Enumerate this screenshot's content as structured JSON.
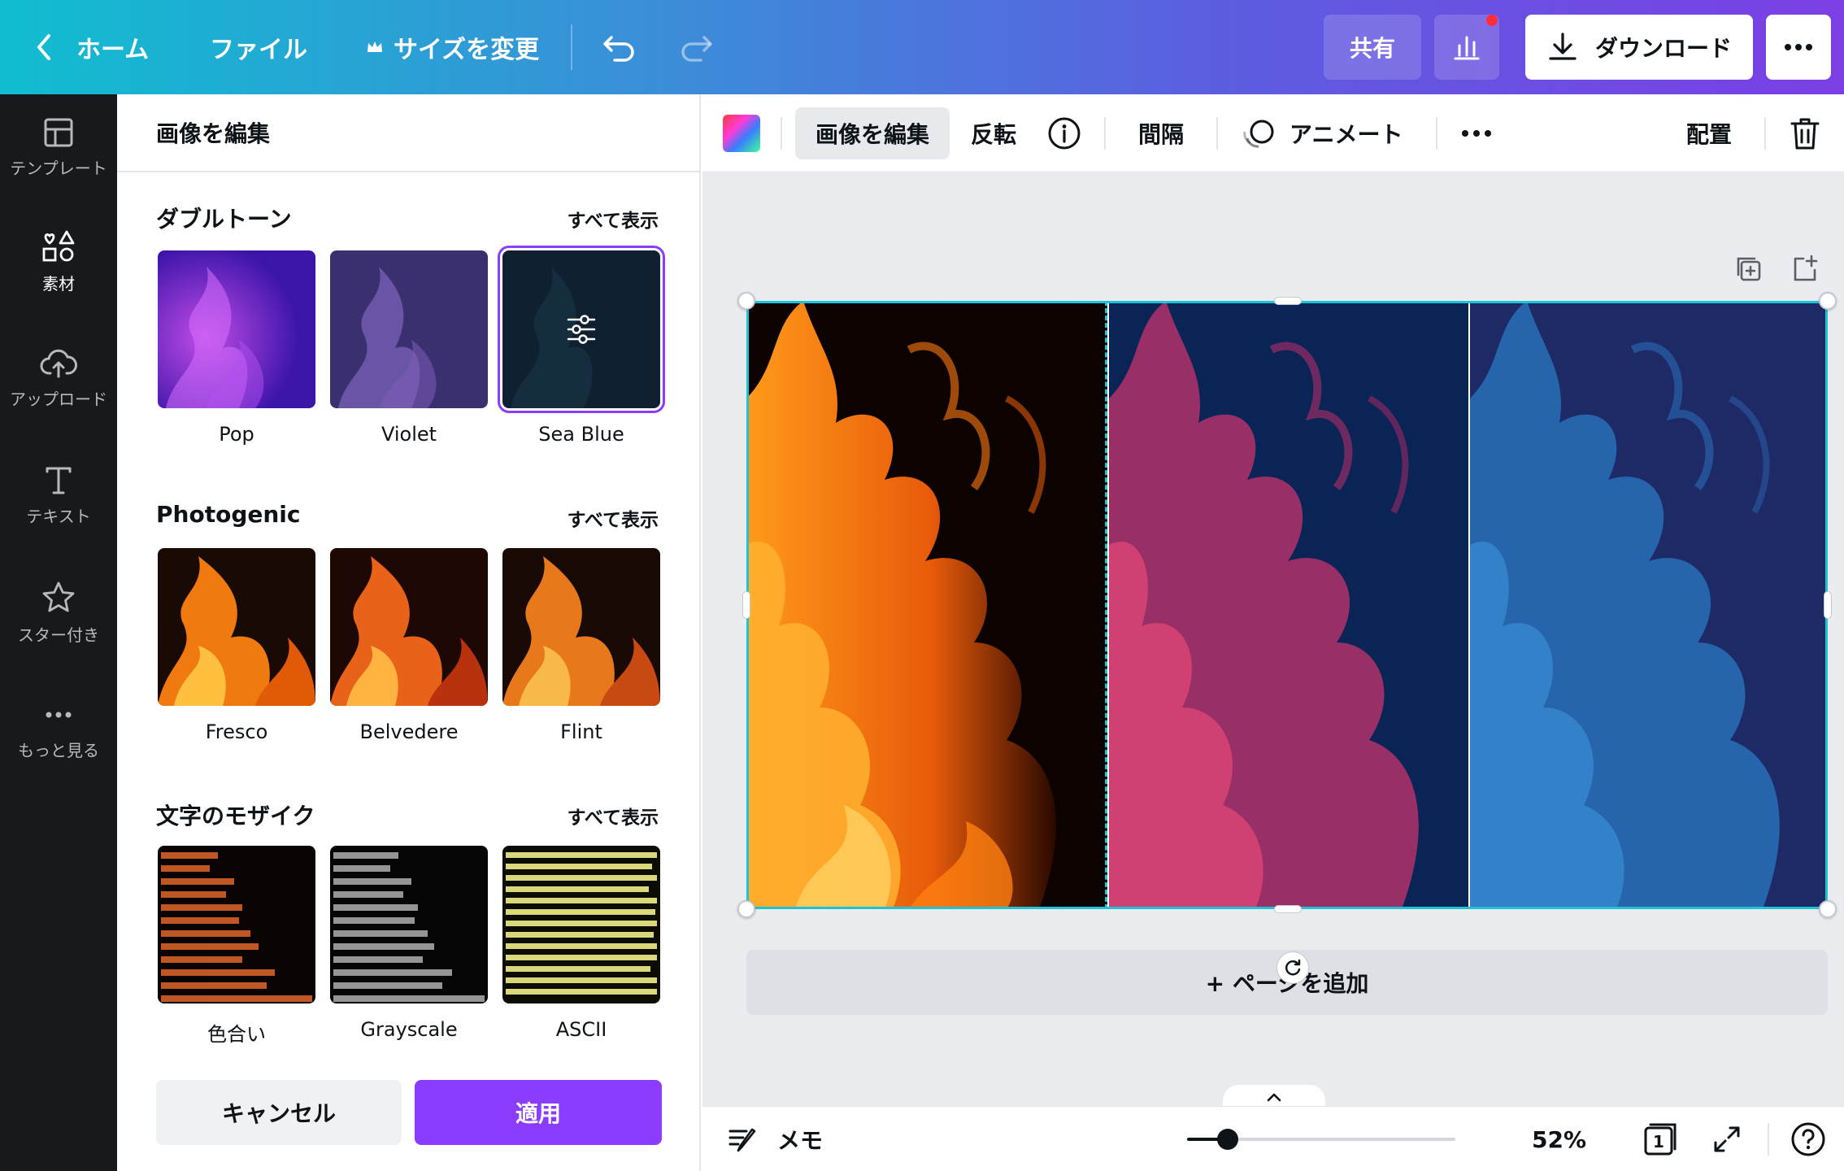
{
  "topbar": {
    "home_label": "ホーム",
    "file_label": "ファイル",
    "resize_label": "サイズを変更",
    "share_label": "共有",
    "download_label": "ダウンロード"
  },
  "rail": {
    "items": [
      {
        "label": "テンプレート",
        "icon": "template-icon"
      },
      {
        "label": "素材",
        "icon": "elements-icon"
      },
      {
        "label": "アップロード",
        "icon": "upload-cloud-icon"
      },
      {
        "label": "テキスト",
        "icon": "text-icon"
      },
      {
        "label": "スター付き",
        "icon": "star-icon"
      },
      {
        "label": "もっと見る",
        "icon": "more-dots-icon"
      }
    ]
  },
  "panel": {
    "title": "画像を編集",
    "sections": [
      {
        "title": "ダブルトーン",
        "show_all": "すべて表示",
        "items": [
          "Pop",
          "Violet",
          "Sea Blue"
        ]
      },
      {
        "title": "Photogenic",
        "show_all": "すべて表示",
        "items": [
          "Fresco",
          "Belvedere",
          "Flint"
        ]
      },
      {
        "title": "文字のモザイク",
        "show_all": "すべて表示",
        "items": [
          "色合い",
          "Grayscale",
          "ASCII"
        ]
      }
    ],
    "cancel_label": "キャンセル",
    "apply_label": "適用"
  },
  "context_bar": {
    "edit_image_label": "画像を編集",
    "flip_label": "反転",
    "spacing_label": "間隔",
    "animate_label": "アニメート",
    "position_label": "配置"
  },
  "canvas": {
    "add_page_label": "+ ページを追加"
  },
  "footer": {
    "notes_label": "メモ",
    "zoom_label": "52%",
    "zoom_value": 0.15,
    "page_count": "1"
  },
  "colors": {
    "accent": "#8b3dff",
    "selection": "#1fc3d6",
    "rail_bg": "#18191b"
  }
}
